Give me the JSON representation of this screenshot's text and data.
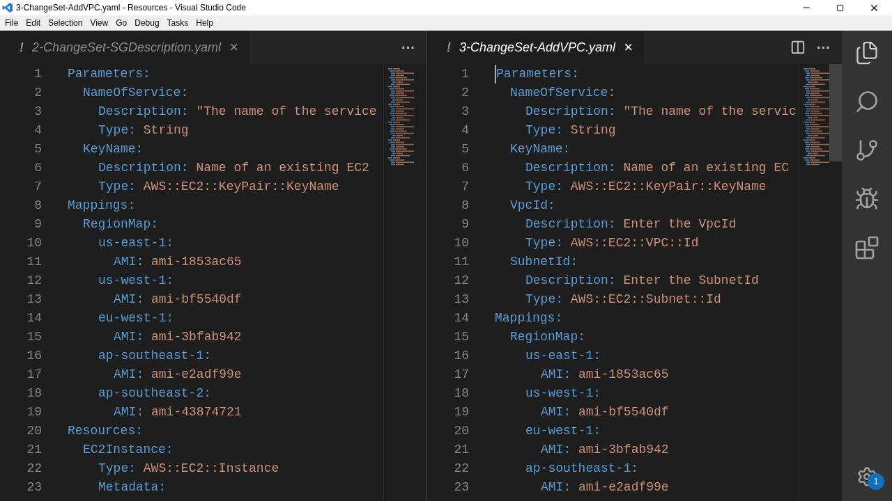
{
  "window": {
    "title": "3-ChangeSet-AddVPC.yaml - Resources - Visual Studio Code"
  },
  "menu": [
    "File",
    "Edit",
    "Selection",
    "View",
    "Go",
    "Debug",
    "Tasks",
    "Help"
  ],
  "groups": [
    {
      "focused": false,
      "split_button": false,
      "tab": {
        "marker": "!",
        "label": "2-ChangeSet-SGDescription.yaml",
        "close": "×"
      },
      "more": "···",
      "lines": [
        {
          "n": "1",
          "key": "Parameters:",
          "children": [
            {
              "n": "2",
              "key": "NameOfService:",
              "children": [
                {
                  "n": "3",
                  "key": "Description:",
                  "value": "\"The name of the service"
                },
                {
                  "n": "4",
                  "key": "Type:",
                  "value": "String"
                }
              ]
            },
            {
              "n": "5",
              "key": "KeyName:",
              "children": [
                {
                  "n": "6",
                  "key": "Description:",
                  "value": "Name of an existing EC2"
                },
                {
                  "n": "7",
                  "key": "Type:",
                  "value": "AWS::EC2::KeyPair::KeyName"
                }
              ]
            }
          ]
        },
        {
          "n": "8",
          "key": "Mappings:",
          "children": [
            {
              "n": "9",
              "key": "RegionMap:",
              "children": [
                {
                  "n": "10",
                  "key": "us-east-1:",
                  "children": [
                    {
                      "n": "11",
                      "key": "AMI:",
                      "value": "ami-1853ac65"
                    }
                  ]
                },
                {
                  "n": "12",
                  "key": "us-west-1:",
                  "children": [
                    {
                      "n": "13",
                      "key": "AMI:",
                      "value": "ami-bf5540df"
                    }
                  ]
                },
                {
                  "n": "14",
                  "key": "eu-west-1:",
                  "children": [
                    {
                      "n": "15",
                      "key": "AMI:",
                      "value": "ami-3bfab942"
                    }
                  ]
                },
                {
                  "n": "16",
                  "key": "ap-southeast-1:",
                  "children": [
                    {
                      "n": "17",
                      "key": "AMI:",
                      "value": "ami-e2adf99e"
                    }
                  ]
                },
                {
                  "n": "18",
                  "key": "ap-southeast-2:",
                  "children": [
                    {
                      "n": "19",
                      "key": "AMI:",
                      "value": "ami-43874721"
                    }
                  ]
                }
              ]
            }
          ]
        },
        {
          "n": "20",
          "key": "Resources:",
          "children": [
            {
              "n": "21",
              "key": "EC2Instance:",
              "children": [
                {
                  "n": "22",
                  "key": "Type:",
                  "value": "AWS::EC2::Instance"
                },
                {
                  "n": "23",
                  "key": "Metadata:"
                }
              ]
            }
          ]
        }
      ]
    },
    {
      "focused": true,
      "split_button": true,
      "tab": {
        "marker": "!",
        "label": "3-ChangeSet-AddVPC.yaml",
        "close": "×"
      },
      "more": "···",
      "lines": [
        {
          "n": "1",
          "key": "Parameters:",
          "children": [
            {
              "n": "2",
              "key": "NameOfService:",
              "children": [
                {
                  "n": "3",
                  "key": "Description:",
                  "value": "\"The name of the servic"
                },
                {
                  "n": "4",
                  "key": "Type:",
                  "value": "String"
                }
              ]
            },
            {
              "n": "5",
              "key": "KeyName:",
              "children": [
                {
                  "n": "6",
                  "key": "Description:",
                  "value": "Name of an existing EC"
                },
                {
                  "n": "7",
                  "key": "Type:",
                  "value": "AWS::EC2::KeyPair::KeyName"
                }
              ]
            },
            {
              "n": "8",
              "key": "VpcId:",
              "children": [
                {
                  "n": "9",
                  "key": "Description:",
                  "value": "Enter the VpcId"
                },
                {
                  "n": "10",
                  "key": "Type:",
                  "value": "AWS::EC2::VPC::Id"
                }
              ]
            },
            {
              "n": "11",
              "key": "SubnetId:",
              "children": [
                {
                  "n": "12",
                  "key": "Description:",
                  "value": "Enter the SubnetId"
                },
                {
                  "n": "13",
                  "key": "Type:",
                  "value": "AWS::EC2::Subnet::Id"
                }
              ]
            }
          ]
        },
        {
          "n": "14",
          "key": "Mappings:",
          "children": [
            {
              "n": "15",
              "key": "RegionMap:",
              "children": [
                {
                  "n": "16",
                  "key": "us-east-1:",
                  "children": [
                    {
                      "n": "17",
                      "key": "AMI:",
                      "value": "ami-1853ac65"
                    }
                  ]
                },
                {
                  "n": "18",
                  "key": "us-west-1:",
                  "children": [
                    {
                      "n": "19",
                      "key": "AMI:",
                      "value": "ami-bf5540df"
                    }
                  ]
                },
                {
                  "n": "20",
                  "key": "eu-west-1:",
                  "children": [
                    {
                      "n": "21",
                      "key": "AMI:",
                      "value": "ami-3bfab942"
                    }
                  ]
                },
                {
                  "n": "22",
                  "key": "ap-southeast-1:",
                  "children": [
                    {
                      "n": "23",
                      "key": "AMI:",
                      "value": "ami-e2adf99e"
                    }
                  ]
                }
              ]
            }
          ]
        }
      ]
    }
  ],
  "activity_bar": {
    "settings_badge": "1"
  }
}
